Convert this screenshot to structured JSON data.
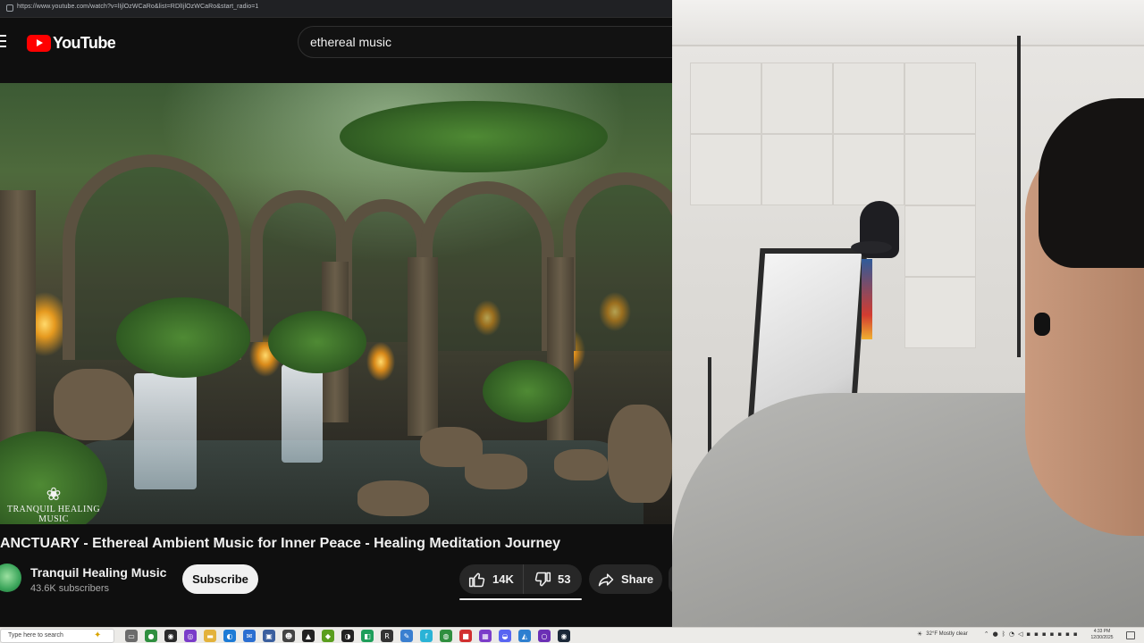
{
  "browser": {
    "url": "https://www.youtube.com/watch?v=lIjlOzWCaRo&list=RDlIjlOzWCaRo&start_radio=1"
  },
  "header": {
    "logo_text": "YouTube",
    "search_query": "ethereal music"
  },
  "video": {
    "brand_mark": "❀",
    "brand_name": "TRANQUIL HEALING MUSIC",
    "title": "ANCTUARY - Ethereal Ambient Music for Inner Peace - Healing Meditation Journey"
  },
  "channel": {
    "name": "Tranquil Healing Music",
    "subscribers": "43.6K subscribers",
    "subscribe_label": "Subscribe"
  },
  "actions": {
    "likes": "14K",
    "dislikes": "53",
    "share_label": "Share"
  },
  "taskbar": {
    "search_placeholder": "Type here to search",
    "weather": "32°F Mostly clear",
    "time": "4:33 PM",
    "date": "12/30/2025",
    "apps": [
      {
        "name": "task-view-icon",
        "glyph": "▭",
        "color": "#6b6b6b"
      },
      {
        "name": "chrome-icon",
        "glyph": "●",
        "color": "#2f8f3f"
      },
      {
        "name": "obs-icon",
        "glyph": "◉",
        "color": "#2a2a2a"
      },
      {
        "name": "app-purple-icon",
        "glyph": "◎",
        "color": "#7a3cc9"
      },
      {
        "name": "file-explorer-icon",
        "glyph": "▬",
        "color": "#e3b23c"
      },
      {
        "name": "edge-icon",
        "glyph": "◐",
        "color": "#1d7bd6"
      },
      {
        "name": "mail-icon",
        "glyph": "✉",
        "color": "#2b6fd1"
      },
      {
        "name": "store-icon",
        "glyph": "▣",
        "color": "#3b5f9e"
      },
      {
        "name": "alien-icon",
        "glyph": "☻",
        "color": "#444"
      },
      {
        "name": "app-a-icon",
        "glyph": "▲",
        "color": "#222"
      },
      {
        "name": "nvidia-icon",
        "glyph": "◆",
        "color": "#5a9e1e"
      },
      {
        "name": "app-cycle-icon",
        "glyph": "◑",
        "color": "#222"
      },
      {
        "name": "app-green-icon",
        "glyph": "◧",
        "color": "#1e9e5a"
      },
      {
        "name": "app-r-icon",
        "glyph": "R",
        "color": "#333"
      },
      {
        "name": "app-pen-icon",
        "glyph": "✎",
        "color": "#3a7fd0"
      },
      {
        "name": "app-f-icon",
        "glyph": "f",
        "color": "#2ab3d6"
      },
      {
        "name": "chrome-active-icon",
        "glyph": "◍",
        "color": "#2f8f3f"
      },
      {
        "name": "app-red-icon",
        "glyph": "■",
        "color": "#d12f2f"
      },
      {
        "name": "app-grid-icon",
        "glyph": "▦",
        "color": "#7b3cc9"
      },
      {
        "name": "discord-icon",
        "glyph": "◒",
        "color": "#5865f2"
      },
      {
        "name": "app-paint-icon",
        "glyph": "◭",
        "color": "#2d7fd0"
      },
      {
        "name": "app-ring-icon",
        "glyph": "○",
        "color": "#6b2fb5"
      },
      {
        "name": "steam-icon",
        "glyph": "◉",
        "color": "#1b2838"
      }
    ]
  },
  "colors": {
    "youtube_red": "#ff0000",
    "background": "#0f0f0f",
    "button_surface": "#272727"
  }
}
